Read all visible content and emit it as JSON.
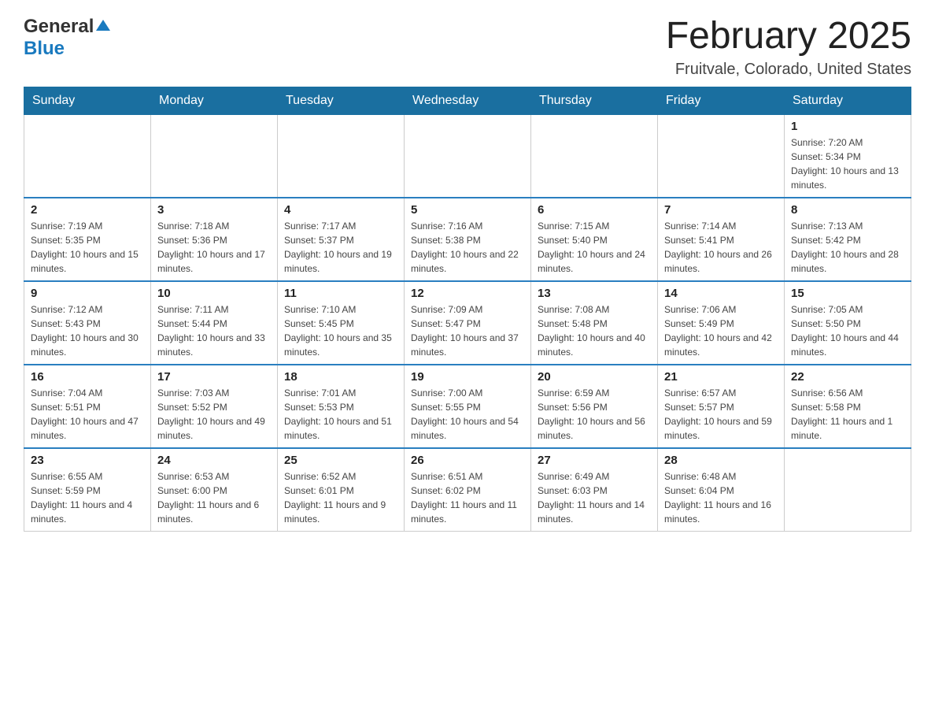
{
  "logo": {
    "general": "General",
    "blue": "Blue"
  },
  "header": {
    "title": "February 2025",
    "location": "Fruitvale, Colorado, United States"
  },
  "weekdays": [
    "Sunday",
    "Monday",
    "Tuesday",
    "Wednesday",
    "Thursday",
    "Friday",
    "Saturday"
  ],
  "weeks": [
    {
      "days": [
        {
          "num": "",
          "info": ""
        },
        {
          "num": "",
          "info": ""
        },
        {
          "num": "",
          "info": ""
        },
        {
          "num": "",
          "info": ""
        },
        {
          "num": "",
          "info": ""
        },
        {
          "num": "",
          "info": ""
        },
        {
          "num": "1",
          "info": "Sunrise: 7:20 AM\nSunset: 5:34 PM\nDaylight: 10 hours and 13 minutes."
        }
      ]
    },
    {
      "days": [
        {
          "num": "2",
          "info": "Sunrise: 7:19 AM\nSunset: 5:35 PM\nDaylight: 10 hours and 15 minutes."
        },
        {
          "num": "3",
          "info": "Sunrise: 7:18 AM\nSunset: 5:36 PM\nDaylight: 10 hours and 17 minutes."
        },
        {
          "num": "4",
          "info": "Sunrise: 7:17 AM\nSunset: 5:37 PM\nDaylight: 10 hours and 19 minutes."
        },
        {
          "num": "5",
          "info": "Sunrise: 7:16 AM\nSunset: 5:38 PM\nDaylight: 10 hours and 22 minutes."
        },
        {
          "num": "6",
          "info": "Sunrise: 7:15 AM\nSunset: 5:40 PM\nDaylight: 10 hours and 24 minutes."
        },
        {
          "num": "7",
          "info": "Sunrise: 7:14 AM\nSunset: 5:41 PM\nDaylight: 10 hours and 26 minutes."
        },
        {
          "num": "8",
          "info": "Sunrise: 7:13 AM\nSunset: 5:42 PM\nDaylight: 10 hours and 28 minutes."
        }
      ]
    },
    {
      "days": [
        {
          "num": "9",
          "info": "Sunrise: 7:12 AM\nSunset: 5:43 PM\nDaylight: 10 hours and 30 minutes."
        },
        {
          "num": "10",
          "info": "Sunrise: 7:11 AM\nSunset: 5:44 PM\nDaylight: 10 hours and 33 minutes."
        },
        {
          "num": "11",
          "info": "Sunrise: 7:10 AM\nSunset: 5:45 PM\nDaylight: 10 hours and 35 minutes."
        },
        {
          "num": "12",
          "info": "Sunrise: 7:09 AM\nSunset: 5:47 PM\nDaylight: 10 hours and 37 minutes."
        },
        {
          "num": "13",
          "info": "Sunrise: 7:08 AM\nSunset: 5:48 PM\nDaylight: 10 hours and 40 minutes."
        },
        {
          "num": "14",
          "info": "Sunrise: 7:06 AM\nSunset: 5:49 PM\nDaylight: 10 hours and 42 minutes."
        },
        {
          "num": "15",
          "info": "Sunrise: 7:05 AM\nSunset: 5:50 PM\nDaylight: 10 hours and 44 minutes."
        }
      ]
    },
    {
      "days": [
        {
          "num": "16",
          "info": "Sunrise: 7:04 AM\nSunset: 5:51 PM\nDaylight: 10 hours and 47 minutes."
        },
        {
          "num": "17",
          "info": "Sunrise: 7:03 AM\nSunset: 5:52 PM\nDaylight: 10 hours and 49 minutes."
        },
        {
          "num": "18",
          "info": "Sunrise: 7:01 AM\nSunset: 5:53 PM\nDaylight: 10 hours and 51 minutes."
        },
        {
          "num": "19",
          "info": "Sunrise: 7:00 AM\nSunset: 5:55 PM\nDaylight: 10 hours and 54 minutes."
        },
        {
          "num": "20",
          "info": "Sunrise: 6:59 AM\nSunset: 5:56 PM\nDaylight: 10 hours and 56 minutes."
        },
        {
          "num": "21",
          "info": "Sunrise: 6:57 AM\nSunset: 5:57 PM\nDaylight: 10 hours and 59 minutes."
        },
        {
          "num": "22",
          "info": "Sunrise: 6:56 AM\nSunset: 5:58 PM\nDaylight: 11 hours and 1 minute."
        }
      ]
    },
    {
      "days": [
        {
          "num": "23",
          "info": "Sunrise: 6:55 AM\nSunset: 5:59 PM\nDaylight: 11 hours and 4 minutes."
        },
        {
          "num": "24",
          "info": "Sunrise: 6:53 AM\nSunset: 6:00 PM\nDaylight: 11 hours and 6 minutes."
        },
        {
          "num": "25",
          "info": "Sunrise: 6:52 AM\nSunset: 6:01 PM\nDaylight: 11 hours and 9 minutes."
        },
        {
          "num": "26",
          "info": "Sunrise: 6:51 AM\nSunset: 6:02 PM\nDaylight: 11 hours and 11 minutes."
        },
        {
          "num": "27",
          "info": "Sunrise: 6:49 AM\nSunset: 6:03 PM\nDaylight: 11 hours and 14 minutes."
        },
        {
          "num": "28",
          "info": "Sunrise: 6:48 AM\nSunset: 6:04 PM\nDaylight: 11 hours and 16 minutes."
        },
        {
          "num": "",
          "info": ""
        }
      ]
    }
  ]
}
